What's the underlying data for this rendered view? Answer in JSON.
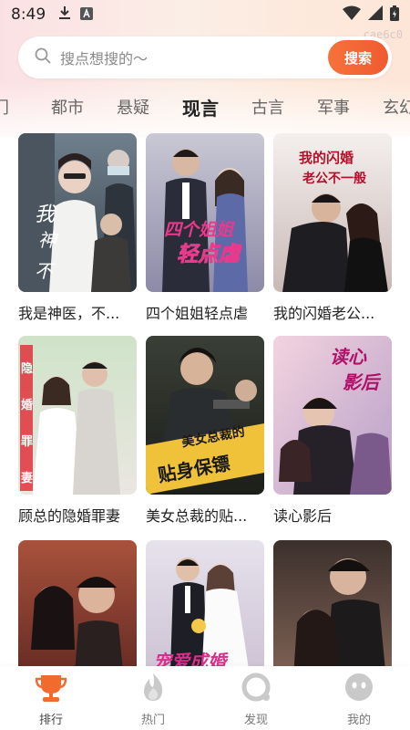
{
  "status": {
    "time": "8:49"
  },
  "watermark": "cae6c0",
  "search": {
    "placeholder": "搜点想搜的～",
    "button_label": "搜索"
  },
  "tabs": [
    {
      "label": "热门",
      "visible": "门"
    },
    {
      "label": "都市"
    },
    {
      "label": "悬疑"
    },
    {
      "label": "现言",
      "active": true
    },
    {
      "label": "古言"
    },
    {
      "label": "军事"
    },
    {
      "label": "玄幻",
      "visible": "玄幻"
    }
  ],
  "dramas": [
    {
      "title": "我是神医，不...",
      "poster_text": "我是神医不是圣"
    },
    {
      "title": "四个姐姐轻点虐",
      "poster_text": "四个姐姐轻点虐"
    },
    {
      "title": "我的闪婚老公...",
      "poster_text": "我的闪婚老公不一般"
    },
    {
      "title": "顾总的隐婚罪妻",
      "poster_text": "隐婚罪妻"
    },
    {
      "title": "美女总裁的贴...",
      "poster_text": "美女总裁的贴身保镖"
    },
    {
      "title": "读心影后",
      "poster_text": "读心影后"
    },
    {
      "title": "",
      "poster_text": ""
    },
    {
      "title": "",
      "poster_text": "宠爱成婚"
    },
    {
      "title": "",
      "poster_text": ""
    }
  ],
  "nav": [
    {
      "label": "排行",
      "icon": "trophy-icon",
      "active": true
    },
    {
      "label": "热门",
      "icon": "flame-icon"
    },
    {
      "label": "发现",
      "icon": "discover-icon"
    },
    {
      "label": "我的",
      "icon": "profile-icon"
    }
  ],
  "colors": {
    "accent": "#f2642f",
    "background_top": "#fbe4e2"
  }
}
